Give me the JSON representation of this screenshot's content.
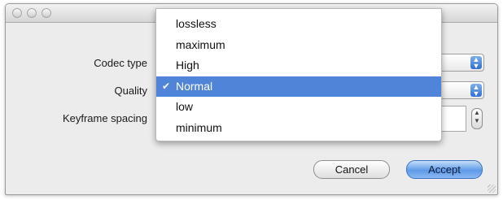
{
  "dialog": {
    "labels": {
      "codec_type": "Codec type",
      "quality": "Quality",
      "keyframe_spacing": "Keyframe spacing"
    },
    "buttons": {
      "cancel": "Cancel",
      "accept": "Accept"
    }
  },
  "quality_menu": {
    "options": [
      "lossless",
      "maximum",
      "High",
      "Normal",
      "low",
      "minimum"
    ],
    "selected": "Normal",
    "checkmark": "✔"
  },
  "icons": {
    "popup_arrows": "popup-arrows-icon",
    "stepper": "stepper-arrows-icon"
  },
  "colors": {
    "menu_highlight": "#4f84d8",
    "accept_button": "#5f9ae8"
  }
}
